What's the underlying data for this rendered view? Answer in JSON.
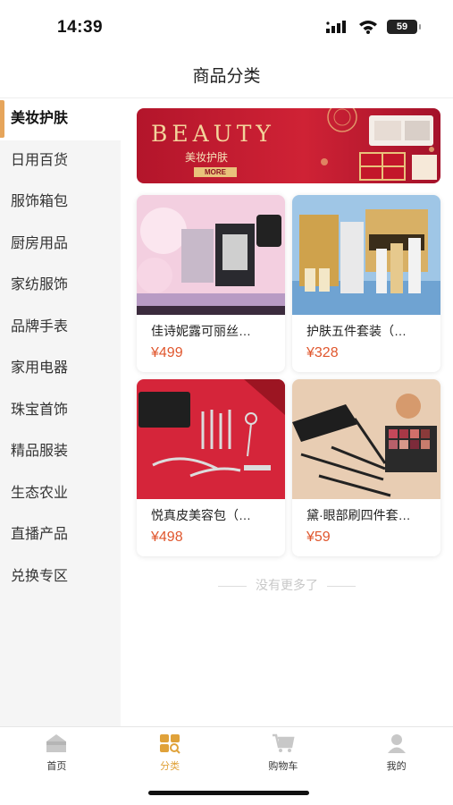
{
  "status_bar": {
    "time": "14:39",
    "battery": "59"
  },
  "header": {
    "title": "商品分类"
  },
  "sidebar": {
    "items": [
      {
        "label": "美妆护肤",
        "active": true
      },
      {
        "label": "日用百货"
      },
      {
        "label": "服饰箱包"
      },
      {
        "label": "厨房用品"
      },
      {
        "label": "家纺服饰"
      },
      {
        "label": "品牌手表"
      },
      {
        "label": "家用电器"
      },
      {
        "label": "珠宝首饰"
      },
      {
        "label": "精品服装"
      },
      {
        "label": "生态农业"
      },
      {
        "label": "直播产品"
      },
      {
        "label": "兑换专区"
      }
    ]
  },
  "banner": {
    "title": "BEAUTY",
    "subtitle": "美妆护肤",
    "more": "MORE"
  },
  "products": [
    {
      "name": "佳诗妮露可丽丝…",
      "price": "¥499"
    },
    {
      "name": "护肤五件套装（…",
      "price": "¥328"
    },
    {
      "name": "悦真皮美容包（…",
      "price": "¥498"
    },
    {
      "name": "黛·眼部刷四件套…",
      "price": "¥59"
    }
  ],
  "footer_note": "没有更多了",
  "tab_bar": {
    "tabs": [
      {
        "label": "首页",
        "icon": "home-icon"
      },
      {
        "label": "分类",
        "icon": "category-icon",
        "active": true
      },
      {
        "label": "购物车",
        "icon": "cart-icon"
      },
      {
        "label": "我的",
        "icon": "profile-icon"
      }
    ]
  },
  "colors": {
    "accent": "#e0a23a",
    "price": "#e0572e",
    "sidebar_active_bar": "#e6a55b"
  }
}
